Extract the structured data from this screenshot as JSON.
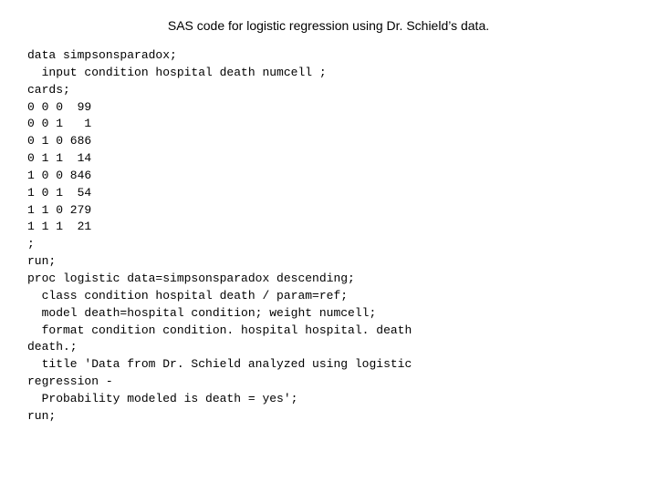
{
  "header": {
    "title": "SAS code for logistic regression using Dr. Schield’s data."
  },
  "code": {
    "lines": [
      "data simpsonsparadox;",
      "  input condition hospital death numcell ;",
      "cards;",
      "0 0 0  99",
      "0 0 1   1",
      "0 1 0 686",
      "0 1 1  14",
      "1 0 0 846",
      "1 0 1  54",
      "1 1 0 279",
      "1 1 1  21",
      ";",
      "run;",
      "proc logistic data=simpsonsparadox descending;",
      "  class condition hospital death / param=ref;",
      "  model death=hospital condition; weight numcell;",
      "  format condition condition. hospital hospital. death",
      "death.;",
      "  title 'Data from Dr. Schield analyzed using logistic",
      "regression -",
      "  Probability modeled is death = yes';",
      "run;"
    ]
  }
}
